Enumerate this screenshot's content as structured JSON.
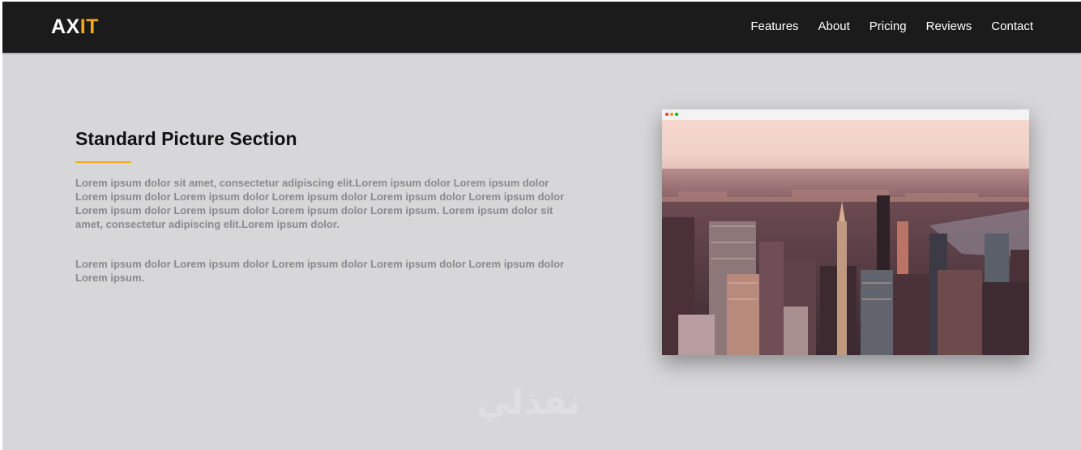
{
  "brand": {
    "logo_primary": "AX",
    "logo_accent": "IT",
    "accent_color": "#f3a81d"
  },
  "nav": {
    "items": [
      "Features",
      "About",
      "Pricing",
      "Reviews",
      "Contact"
    ]
  },
  "section": {
    "title": "Standard Picture Section",
    "paragraphs": [
      "Lorem ipsum dolor sit amet, consectetur adipiscing elit.Lorem ipsum dolor Lorem ipsum dolor Lorem ipsum dolor Lorem ipsum dolor Lorem ipsum dolor Lorem ipsum dolor Lorem ipsum dolor Lorem ipsum dolor Lorem ipsum dolor Lorem ipsum dolor Lorem ipsum. Lorem ipsum dolor sit amet, consectetur adipiscing elit.Lorem ipsum dolor.",
      "Lorem ipsum dolor Lorem ipsum dolor Lorem ipsum dolor Lorem ipsum dolor Lorem ipsum dolor Lorem ipsum."
    ]
  },
  "image": {
    "subject": "aerial city skyline photo",
    "window_dots": [
      "red",
      "yellow",
      "green"
    ]
  },
  "watermark": {
    "text": "نفذلي"
  }
}
